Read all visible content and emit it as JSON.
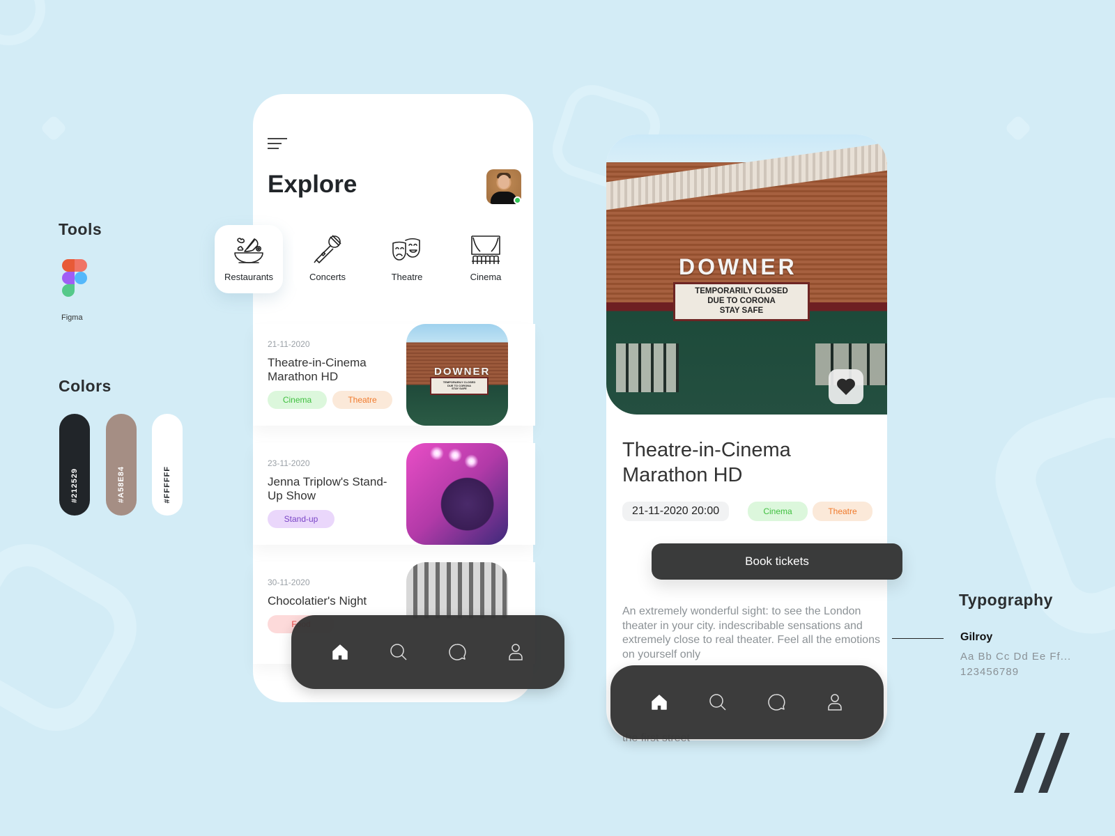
{
  "tools": {
    "title": "Tools",
    "items": [
      {
        "name": "Figma",
        "icon": "figma-logo"
      }
    ]
  },
  "colors": {
    "title": "Colors",
    "swatches": [
      {
        "hex": "#212529",
        "label": "#212529"
      },
      {
        "hex": "#A58E84",
        "label": "#A58E84"
      },
      {
        "hex": "#FFFFFF",
        "label": "#FFFFFF"
      }
    ]
  },
  "explore_screen": {
    "title": "Explore",
    "menu_icon": "hamburger-menu-icon",
    "avatar": {
      "status": "online",
      "status_color": "#34c759"
    },
    "categories": [
      {
        "label": "Restaurants",
        "icon": "salad-bowl-icon",
        "active": true
      },
      {
        "label": "Concerts",
        "icon": "microphone-icon",
        "active": false
      },
      {
        "label": "Theatre",
        "icon": "theatre-masks-icon",
        "active": false
      },
      {
        "label": "Cinema",
        "icon": "cinema-screen-icon",
        "active": false
      }
    ],
    "events": [
      {
        "date": "21-11-2020",
        "title": "Theatre-in-Cinema Marathon HD",
        "tags": [
          "Cinema",
          "Theatre"
        ],
        "image": "theatre-facade-photo",
        "marquee": {
          "sign": "DOWNER",
          "lines": [
            "TEMPORARILY  CLOSED",
            "DUE  TO  CORONA",
            "STAY SAFE"
          ]
        }
      },
      {
        "date": "23-11-2020",
        "title": "Jenna Triplow's Stand-Up Show",
        "tags": [
          "Stand-up"
        ],
        "image": "concert-singer-photo"
      },
      {
        "date": "30-11-2020",
        "title": "Chocolatier's Night",
        "tags": [
          "Food"
        ],
        "image": "chocolate-drink-photo"
      }
    ],
    "nav": [
      {
        "label": "Home",
        "icon": "home-icon",
        "active": true
      },
      {
        "label": "Search",
        "icon": "search-icon",
        "active": false
      },
      {
        "label": "Messages",
        "icon": "chat-bubble-icon",
        "active": false
      },
      {
        "label": "Profile",
        "icon": "user-icon",
        "active": false
      }
    ]
  },
  "detail_screen": {
    "title": "Theatre-in-Cinema Marathon HD",
    "datetime": "21-11-2020 20:00",
    "tags": [
      "Cinema",
      "Theatre"
    ],
    "favorite_icon": "heart-icon",
    "book_button": "Book tickets",
    "description": "An extremely wonderful sight: to see the London theater in your city. indescribable sensations and extremely close to real theater. Feel all the emotions on yourself only",
    "description_tail": "the first street",
    "hero": {
      "sign": "DOWNER",
      "lines": [
        "TEMPORARILY  CLOSED",
        "DUE  TO  CORONA",
        "STAY SAFE"
      ]
    }
  },
  "tag_colors": {
    "Cinema": {
      "bg": "#dcf7dc",
      "fg": "#3fbf3f"
    },
    "Theatre": {
      "bg": "#fbe9d9",
      "fg": "#f07a2c"
    },
    "Stand-up": {
      "bg": "#ead7fb",
      "fg": "#7a45c6"
    },
    "Food": {
      "bg": "#fddada",
      "fg": "#e94545"
    }
  },
  "typography": {
    "title": "Typography",
    "font_name": "Gilroy",
    "sample_letters": "Aa Bb Cc Dd Ee Ff...",
    "sample_numbers": "123456789"
  },
  "brand": {
    "mark": "double-slash-logo"
  }
}
